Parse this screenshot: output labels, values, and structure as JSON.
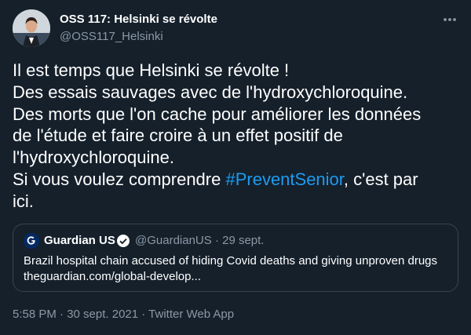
{
  "author": {
    "display_name": "OSS 117: Helsinki se révolte",
    "handle": "@OSS117_Helsinki",
    "avatar_icon": "profile-photo"
  },
  "menu": {
    "icon": "more-horizontal-icon"
  },
  "tweet": {
    "lines": [
      "Il est temps que Helsinki se révolte !",
      "Des essais sauvages avec de l'hydroxychloroquine.",
      "Des morts que l'on cache pour améliorer les données",
      "de l'étude et faire croire à un effet positif de",
      "l'hydroxychloroquine."
    ],
    "last_line_before": "Si vous voulez comprendre ",
    "hashtag": "#PreventSenior",
    "last_line_after": ", c'est par",
    "final_line": "ici."
  },
  "quote": {
    "display_name": "Guardian US",
    "verified_icon": "verified-badge-icon",
    "meta": "@GuardianUS · 29 sept.",
    "text_line1": "Brazil hospital chain accused of hiding Covid deaths and giving unproven drugs",
    "text_line2": "theguardian.com/global-develop..."
  },
  "footer": {
    "timestamp": "5:58 PM · 30 sept. 2021 · Twitter Web App"
  },
  "colors": {
    "background": "#15202b",
    "accent": "#1d9bf0",
    "secondary_text": "#8b98a5",
    "border": "#38444d"
  }
}
